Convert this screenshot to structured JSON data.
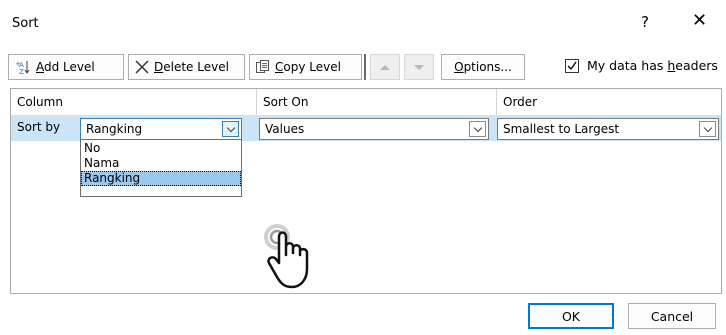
{
  "dialog": {
    "title": "Sort",
    "help_label": "?",
    "close_label": "✕"
  },
  "toolbar": {
    "add_level": {
      "prefix": "",
      "underlined": "A",
      "rest": "dd Level",
      "icon": "add-level-icon"
    },
    "delete_level": {
      "underlined": "D",
      "rest": "elete Level",
      "icon": "delete-x-icon"
    },
    "copy_level": {
      "underlined": "C",
      "rest": "opy Level",
      "icon": "copy-icon"
    },
    "options": {
      "underlined": "O",
      "rest": "ptions..."
    },
    "headers_checkbox": {
      "label_pre": "My data has ",
      "underlined": "h",
      "label_post": "eaders",
      "checked": true
    }
  },
  "grid": {
    "headers": {
      "column": "Column",
      "sort_on": "Sort On",
      "order": "Order"
    },
    "row": {
      "label": "Sort by",
      "column_value": "Rangking",
      "sort_on_value": "Values",
      "order_value": "Smallest to Largest"
    },
    "dropdown_options": [
      "No",
      "Nama",
      "Rangking"
    ],
    "dropdown_selected_index": 2
  },
  "buttons": {
    "ok": "OK",
    "cancel": "Cancel"
  },
  "colors": {
    "selected_row": "#cce4f7",
    "dropdown_highlight": "#99c9ef",
    "ok_border": "#0078d7"
  }
}
